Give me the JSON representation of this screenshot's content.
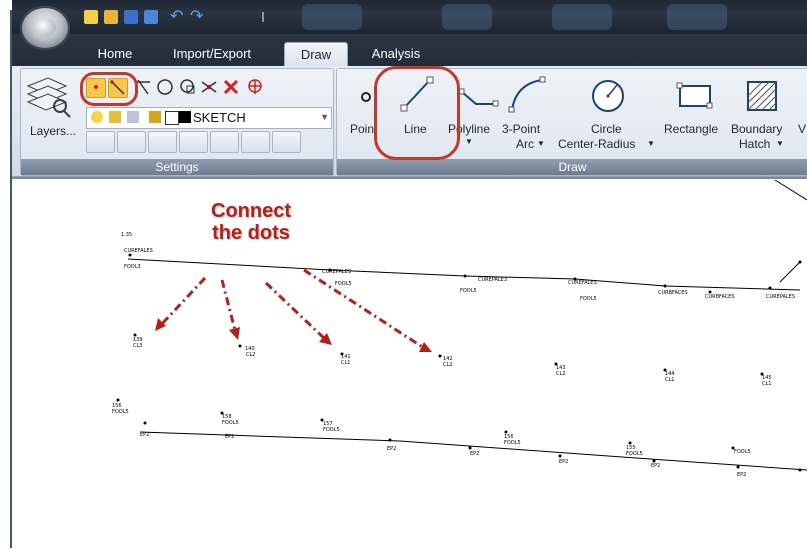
{
  "ribbon": {
    "tabs": [
      {
        "label": "Home"
      },
      {
        "label": "Import/Export"
      },
      {
        "label": "Draw"
      },
      {
        "label": "Analysis"
      }
    ],
    "active_tab": "Draw",
    "settings_group": {
      "label": "Settings",
      "layers_label": "Layers...",
      "current_layer": "SKETCH"
    },
    "draw_group": {
      "label": "Draw",
      "tools": [
        {
          "label": "Point"
        },
        {
          "label": "Line"
        },
        {
          "label": "Polyline"
        },
        {
          "label": "3-Point Arc"
        },
        {
          "label": "Circle Center-Radius"
        },
        {
          "label": "Rectangle"
        },
        {
          "label": "Boundary Hatch"
        }
      ],
      "tool_labels": {
        "point": "Poin",
        "line": "Line",
        "polyline": "Polyline",
        "arc_line1": "3-Point",
        "arc_line2": "Arc",
        "circle_line1": "Circle",
        "circle_line2": "Center-Radius",
        "rectangle": "Rectangle",
        "hatch_line1": "Boundary",
        "hatch_line2": "Hatch",
        "cut": "V"
      }
    }
  },
  "canvas": {
    "annotation_line1": "Connect",
    "annotation_line2": "the dots",
    "point_labels": [
      "CL3",
      "CL2",
      "CL1",
      "CL2",
      "CL2",
      "CL1",
      "CL1",
      "EP2",
      "EP2",
      "EP2",
      "EP2",
      "EP2",
      "EP2",
      "FOOL3",
      "FOOL5",
      "FOOL5",
      "FOOL5",
      "CUREPALES",
      "CUREFALES",
      "CUREPALE3",
      "CURBFACES",
      "139",
      "140",
      "141",
      "142",
      "143",
      "144",
      "145",
      "156",
      "158",
      "157",
      "155"
    ]
  },
  "colors": {
    "highlight": "#c0392b",
    "annotation": "#b3201c",
    "title_bar": "#1e2733",
    "ribbon": "#dde5ef"
  }
}
